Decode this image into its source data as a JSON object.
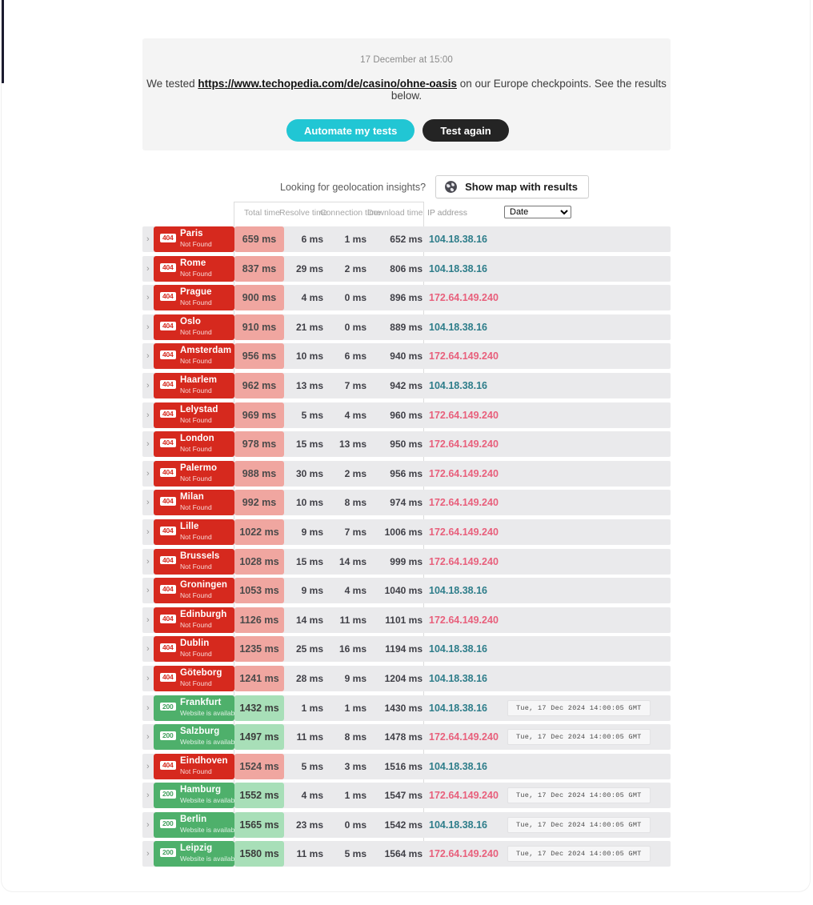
{
  "banner": {
    "date": "17 December at 15:00",
    "text_before": "We tested ",
    "url": "https://www.techopedia.com/de/casino/ohne-oasis",
    "text_after": " on our Europe checkpoints. See the results below.",
    "automate_label": "Automate my tests",
    "test_again_label": "Test again"
  },
  "geolocation": {
    "prompt": "Looking for geolocation insights?",
    "map_button_label": "Show map with results",
    "map_button_icon": "globe-icon"
  },
  "table": {
    "headers": {
      "total": "Total time",
      "resolve": "Resolve time",
      "connection": "Connection time",
      "download": "Download time",
      "ip": "IP address"
    },
    "sort": {
      "selected": "Date",
      "options": [
        "Date",
        "Total time",
        "Resolve time",
        "Connection time",
        "Download time",
        "IP address"
      ]
    },
    "status_labels": {
      "not_found": "Not Found",
      "available": "Website is available"
    },
    "rows": [
      {
        "city": "Paris",
        "code": "404",
        "status": "Not Found",
        "state": "err",
        "total": "659 ms",
        "resolve": "6 ms",
        "connection": "1 ms",
        "download": "652 ms",
        "ip": "104.18.38.16",
        "ip_color": "teal",
        "date": ""
      },
      {
        "city": "Rome",
        "code": "404",
        "status": "Not Found",
        "state": "err",
        "total": "837 ms",
        "resolve": "29 ms",
        "connection": "2 ms",
        "download": "806 ms",
        "ip": "104.18.38.16",
        "ip_color": "teal",
        "date": ""
      },
      {
        "city": "Prague",
        "code": "404",
        "status": "Not Found",
        "state": "err",
        "total": "900 ms",
        "resolve": "4 ms",
        "connection": "0 ms",
        "download": "896 ms",
        "ip": "172.64.149.240",
        "ip_color": "pink",
        "date": ""
      },
      {
        "city": "Oslo",
        "code": "404",
        "status": "Not Found",
        "state": "err",
        "total": "910 ms",
        "resolve": "21 ms",
        "connection": "0 ms",
        "download": "889 ms",
        "ip": "104.18.38.16",
        "ip_color": "teal",
        "date": ""
      },
      {
        "city": "Amsterdam",
        "code": "404",
        "status": "Not Found",
        "state": "err",
        "total": "956 ms",
        "resolve": "10 ms",
        "connection": "6 ms",
        "download": "940 ms",
        "ip": "172.64.149.240",
        "ip_color": "pink",
        "date": ""
      },
      {
        "city": "Haarlem",
        "code": "404",
        "status": "Not Found",
        "state": "err",
        "total": "962 ms",
        "resolve": "13 ms",
        "connection": "7 ms",
        "download": "942 ms",
        "ip": "104.18.38.16",
        "ip_color": "teal",
        "date": ""
      },
      {
        "city": "Lelystad",
        "code": "404",
        "status": "Not Found",
        "state": "err",
        "total": "969 ms",
        "resolve": "5 ms",
        "connection": "4 ms",
        "download": "960 ms",
        "ip": "172.64.149.240",
        "ip_color": "pink",
        "date": ""
      },
      {
        "city": "London",
        "code": "404",
        "status": "Not Found",
        "state": "err",
        "total": "978 ms",
        "resolve": "15 ms",
        "connection": "13 ms",
        "download": "950 ms",
        "ip": "172.64.149.240",
        "ip_color": "pink",
        "date": ""
      },
      {
        "city": "Palermo",
        "code": "404",
        "status": "Not Found",
        "state": "err",
        "total": "988 ms",
        "resolve": "30 ms",
        "connection": "2 ms",
        "download": "956 ms",
        "ip": "172.64.149.240",
        "ip_color": "pink",
        "date": ""
      },
      {
        "city": "Milan",
        "code": "404",
        "status": "Not Found",
        "state": "err",
        "total": "992 ms",
        "resolve": "10 ms",
        "connection": "8 ms",
        "download": "974 ms",
        "ip": "172.64.149.240",
        "ip_color": "pink",
        "date": ""
      },
      {
        "city": "Lille",
        "code": "404",
        "status": "Not Found",
        "state": "err",
        "total": "1022 ms",
        "resolve": "9 ms",
        "connection": "7 ms",
        "download": "1006 ms",
        "ip": "172.64.149.240",
        "ip_color": "pink",
        "date": ""
      },
      {
        "city": "Brussels",
        "code": "404",
        "status": "Not Found",
        "state": "err",
        "total": "1028 ms",
        "resolve": "15 ms",
        "connection": "14 ms",
        "download": "999 ms",
        "ip": "172.64.149.240",
        "ip_color": "pink",
        "date": ""
      },
      {
        "city": "Groningen",
        "code": "404",
        "status": "Not Found",
        "state": "err",
        "total": "1053 ms",
        "resolve": "9 ms",
        "connection": "4 ms",
        "download": "1040 ms",
        "ip": "104.18.38.16",
        "ip_color": "teal",
        "date": ""
      },
      {
        "city": "Edinburgh",
        "code": "404",
        "status": "Not Found",
        "state": "err",
        "total": "1126 ms",
        "resolve": "14 ms",
        "connection": "11 ms",
        "download": "1101 ms",
        "ip": "172.64.149.240",
        "ip_color": "pink",
        "date": ""
      },
      {
        "city": "Dublin",
        "code": "404",
        "status": "Not Found",
        "state": "err",
        "total": "1235 ms",
        "resolve": "25 ms",
        "connection": "16 ms",
        "download": "1194 ms",
        "ip": "104.18.38.16",
        "ip_color": "teal",
        "date": ""
      },
      {
        "city": "Göteborg",
        "code": "404",
        "status": "Not Found",
        "state": "err",
        "total": "1241 ms",
        "resolve": "28 ms",
        "connection": "9 ms",
        "download": "1204 ms",
        "ip": "104.18.38.16",
        "ip_color": "teal",
        "date": ""
      },
      {
        "city": "Frankfurt",
        "code": "200",
        "status": "Website is available",
        "state": "ok",
        "total": "1432 ms",
        "resolve": "1 ms",
        "connection": "1 ms",
        "download": "1430 ms",
        "ip": "104.18.38.16",
        "ip_color": "teal",
        "date": "Tue, 17 Dec 2024 14:00:05 GMT"
      },
      {
        "city": "Salzburg",
        "code": "200",
        "status": "Website is available",
        "state": "ok",
        "total": "1497 ms",
        "resolve": "11 ms",
        "connection": "8 ms",
        "download": "1478 ms",
        "ip": "172.64.149.240",
        "ip_color": "pink",
        "date": "Tue, 17 Dec 2024 14:00:05 GMT"
      },
      {
        "city": "Eindhoven",
        "code": "404",
        "status": "Not Found",
        "state": "err",
        "total": "1524 ms",
        "resolve": "5 ms",
        "connection": "3 ms",
        "download": "1516 ms",
        "ip": "104.18.38.16",
        "ip_color": "teal",
        "date": ""
      },
      {
        "city": "Hamburg",
        "code": "200",
        "status": "Website is available",
        "state": "ok",
        "total": "1552 ms",
        "resolve": "4 ms",
        "connection": "1 ms",
        "download": "1547 ms",
        "ip": "172.64.149.240",
        "ip_color": "pink",
        "date": "Tue, 17 Dec 2024 14:00:05 GMT"
      },
      {
        "city": "Berlin",
        "code": "200",
        "status": "Website is available",
        "state": "ok",
        "total": "1565 ms",
        "resolve": "23 ms",
        "connection": "0 ms",
        "download": "1542 ms",
        "ip": "104.18.38.16",
        "ip_color": "teal",
        "date": "Tue, 17 Dec 2024 14:00:05 GMT"
      },
      {
        "city": "Leipzig",
        "code": "200",
        "status": "Website is available",
        "state": "ok",
        "total": "1580 ms",
        "resolve": "11 ms",
        "connection": "5 ms",
        "download": "1564 ms",
        "ip": "172.64.149.240",
        "ip_color": "pink",
        "date": "Tue, 17 Dec 2024 14:00:05 GMT"
      }
    ]
  },
  "colors": {
    "error_red": "#d6291e",
    "error_tint": "#f0a6a0",
    "ok_green": "#4eb06b",
    "ok_tint": "#a8dfb8",
    "accent_cyan": "#21c6d4",
    "dark_button": "#242424",
    "ip_teal": "#2e7d8a",
    "ip_pink": "#e8607c",
    "row_bg": "#eaeaec"
  }
}
